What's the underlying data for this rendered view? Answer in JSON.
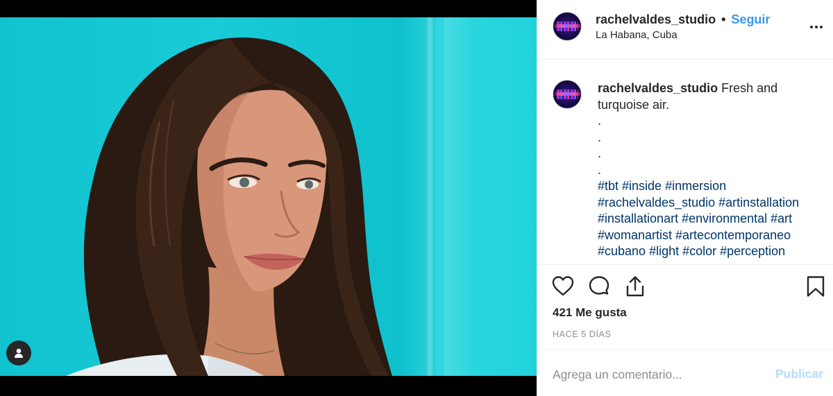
{
  "post": {
    "username": "rachelvaldes_studio",
    "separator": "•",
    "follow_label": "Seguir",
    "location": "La Habana, Cuba"
  },
  "caption": {
    "author": "rachelvaldes_studio",
    "text": "Fresh and turquoise air.",
    "dots": [
      ".",
      ".",
      ".",
      "."
    ],
    "hashtag_lines": [
      "#tbt #inside #inmersion",
      "#rachelvaldes_studio #artinstallation",
      "#installationart #environmental #art",
      "#womanartist #artecontemporaneo",
      "#cubano #light #color #perception"
    ]
  },
  "stats": {
    "likes": "421 Me gusta",
    "time": "HACE 5 DÍAS"
  },
  "comment": {
    "placeholder": "Agrega un comentario...",
    "publish_label": "Publicar"
  },
  "icons": {
    "like": "heart-icon",
    "comment": "comment-bubble-icon",
    "share": "share-icon",
    "save": "bookmark-icon",
    "more": "more-options-icon",
    "tagged_user": "user-icon"
  },
  "colors": {
    "follow": "#3897f0",
    "hashtag": "#003569",
    "publish_disabled": "#b3dbff",
    "backdrop": "#19cbd7"
  }
}
